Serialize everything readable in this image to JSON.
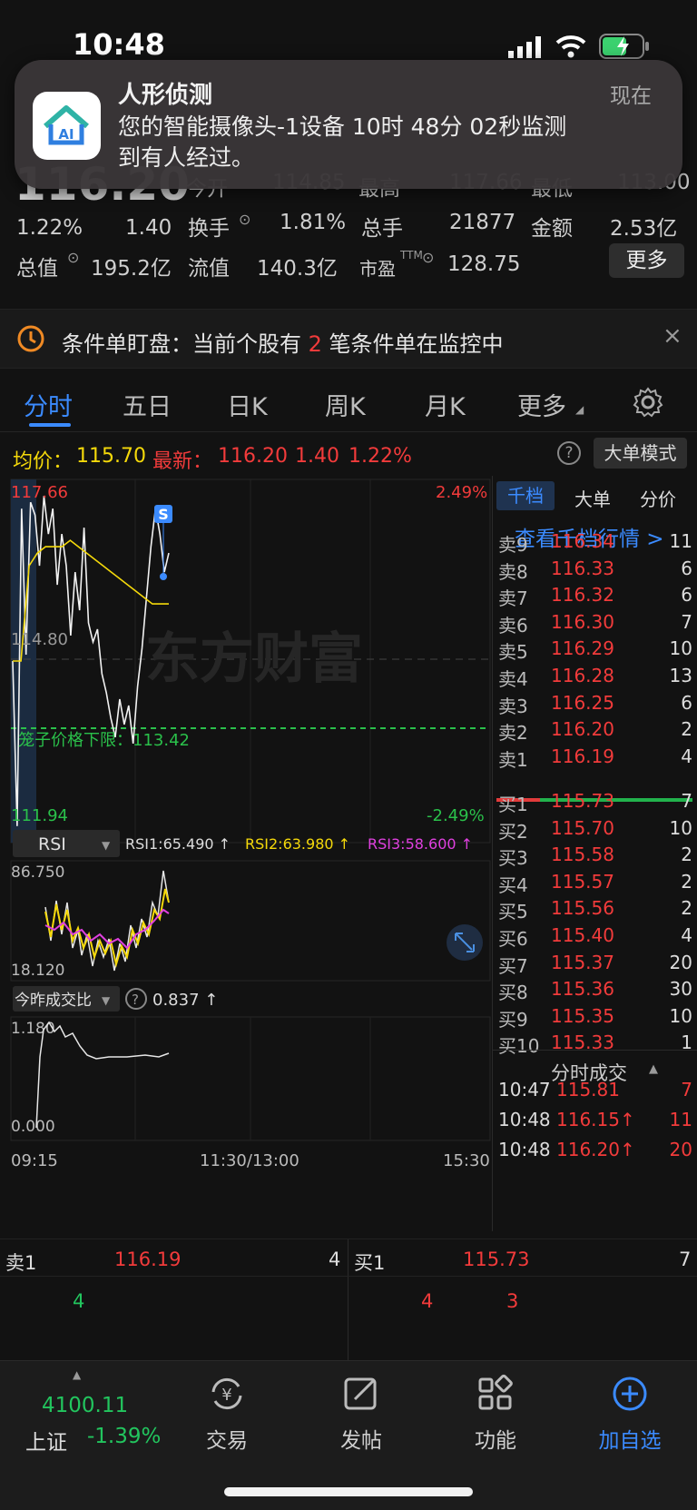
{
  "status_bar": {
    "time": "10:48"
  },
  "notification": {
    "title": "人形侦测",
    "time": "现在",
    "body_line1": "您的智能摄像头-1设备 10时 48分 02秒监测",
    "body_line2": "到有人经过。",
    "icon_text": "AI"
  },
  "quote": {
    "price": "116.20",
    "change_pct": "1.22%",
    "change": "1.40",
    "open_label": "今开",
    "open": "114.85",
    "high_label": "最高",
    "high": "117.66",
    "low_label": "最低",
    "low": "113.00",
    "turnover_label": "换手",
    "turnover": "1.81%",
    "volume_label": "总手",
    "volume": "21877",
    "amount_label": "金额",
    "amount": "2.53亿",
    "total_value_label": "总值",
    "total_value": "195.2亿",
    "float_value_label": "流值",
    "float_value": "140.3亿",
    "pe_label": "市盈",
    "pe_sup": "TTM",
    "pe": "128.75",
    "more_button": "更多"
  },
  "condition_bar": {
    "prefix": "条件单盯盘：当前个股有 ",
    "count": "2",
    "suffix": " 笔条件单在监控中"
  },
  "tabs": [
    {
      "label": "分时",
      "active": true
    },
    {
      "label": "五日"
    },
    {
      "label": "日K"
    },
    {
      "label": "周K"
    },
    {
      "label": "月K"
    },
    {
      "label": "更多"
    }
  ],
  "info_line": {
    "avg_label": "均价：",
    "avg": "115.70",
    "latest_label": "最新：",
    "latest": "116.20",
    "chg": "1.40",
    "pct": "1.22%",
    "mode_button": "大单模式"
  },
  "chart_data": {
    "type": "line",
    "title": "",
    "y_max": "117.66",
    "y_max_pct": "2.49%",
    "y_min": "111.94",
    "y_min_pct": "-2.49%",
    "mid_label": "114.80",
    "cage_label": "笼子价格下限：113.42",
    "marker": "S",
    "watermark": "东方财富",
    "ylim": [
      111.94,
      117.66
    ],
    "price_series": [
      114.8,
      112.2,
      117.2,
      114.9,
      117.3,
      117.1,
      116.3,
      117.4,
      116.8,
      117.2,
      116.0,
      116.8,
      116.3,
      115.2,
      116.2,
      115.6,
      116.9,
      115.4,
      115.1,
      115.3,
      114.6,
      114.3,
      113.9,
      113.6,
      114.2,
      113.8,
      114.1,
      113.5,
      114.4,
      115.0,
      115.8,
      116.6,
      117.2,
      116.8,
      116.2,
      116.5
    ],
    "avg_series": [
      114.8,
      114.8,
      116.3,
      116.5,
      116.6,
      116.6,
      116.6,
      116.7,
      116.6,
      116.5,
      116.4,
      116.3,
      116.2,
      116.1,
      116.0,
      115.9,
      115.8,
      115.7,
      115.7,
      115.7
    ],
    "x_labels": [
      "09:15",
      "11:30/13:00",
      "15:30"
    ]
  },
  "rsi": {
    "selector": "RSI",
    "rsi1": "RSI1:65.490 ↑",
    "rsi2": "RSI2:63.980 ↑",
    "rsi3": "RSI3:58.600 ↑",
    "max": "86.750",
    "min": "18.120"
  },
  "volume_ratio": {
    "selector": "今昨成交比",
    "value": "0.837 ↑",
    "max": "1.180",
    "min": "0.000"
  },
  "order_book": {
    "tabs": [
      "千档",
      "大单",
      "分价"
    ],
    "link": "查看千档行情 >",
    "sells": [
      {
        "label": "卖9",
        "price": "116.34",
        "vol": "11"
      },
      {
        "label": "卖8",
        "price": "116.33",
        "vol": "6"
      },
      {
        "label": "卖7",
        "price": "116.32",
        "vol": "6"
      },
      {
        "label": "卖6",
        "price": "116.30",
        "vol": "7"
      },
      {
        "label": "卖5",
        "price": "116.29",
        "vol": "10"
      },
      {
        "label": "卖4",
        "price": "116.28",
        "vol": "13"
      },
      {
        "label": "卖3",
        "price": "116.25",
        "vol": "6"
      },
      {
        "label": "卖2",
        "price": "116.20",
        "vol": "2"
      },
      {
        "label": "卖1",
        "price": "116.19",
        "vol": "4"
      }
    ],
    "buys": [
      {
        "label": "买1",
        "price": "115.73",
        "vol": "7"
      },
      {
        "label": "买2",
        "price": "115.70",
        "vol": "10"
      },
      {
        "label": "买3",
        "price": "115.58",
        "vol": "2"
      },
      {
        "label": "买4",
        "price": "115.57",
        "vol": "2"
      },
      {
        "label": "买5",
        "price": "115.56",
        "vol": "2"
      },
      {
        "label": "买6",
        "price": "115.40",
        "vol": "4"
      },
      {
        "label": "买7",
        "price": "115.37",
        "vol": "20"
      },
      {
        "label": "买8",
        "price": "115.36",
        "vol": "30"
      },
      {
        "label": "买9",
        "price": "115.35",
        "vol": "10"
      },
      {
        "label": "买10",
        "price": "115.33",
        "vol": "1"
      }
    ],
    "ticks_header": "分时成交",
    "ticks": [
      {
        "time": "10:47",
        "price": "115.81",
        "vol": "7"
      },
      {
        "time": "10:48",
        "price": "116.15↑",
        "vol": "11"
      },
      {
        "time": "10:48",
        "price": "116.20↑",
        "vol": "20"
      }
    ]
  },
  "bottom_quote": {
    "sell_label": "卖1",
    "sell_price": "116.19",
    "sell_vol": "4",
    "sell_sub": "4",
    "buy_label": "买1",
    "buy_price": "115.73",
    "buy_vol": "7",
    "buy_sub1": "4",
    "buy_sub2": "3"
  },
  "bottom_nav": {
    "index_value": "4100.11",
    "index_name": "上证",
    "index_change": "-1.39%",
    "items": [
      {
        "label": "交易"
      },
      {
        "label": "发帖"
      },
      {
        "label": "功能"
      },
      {
        "label": "加自选"
      }
    ]
  }
}
